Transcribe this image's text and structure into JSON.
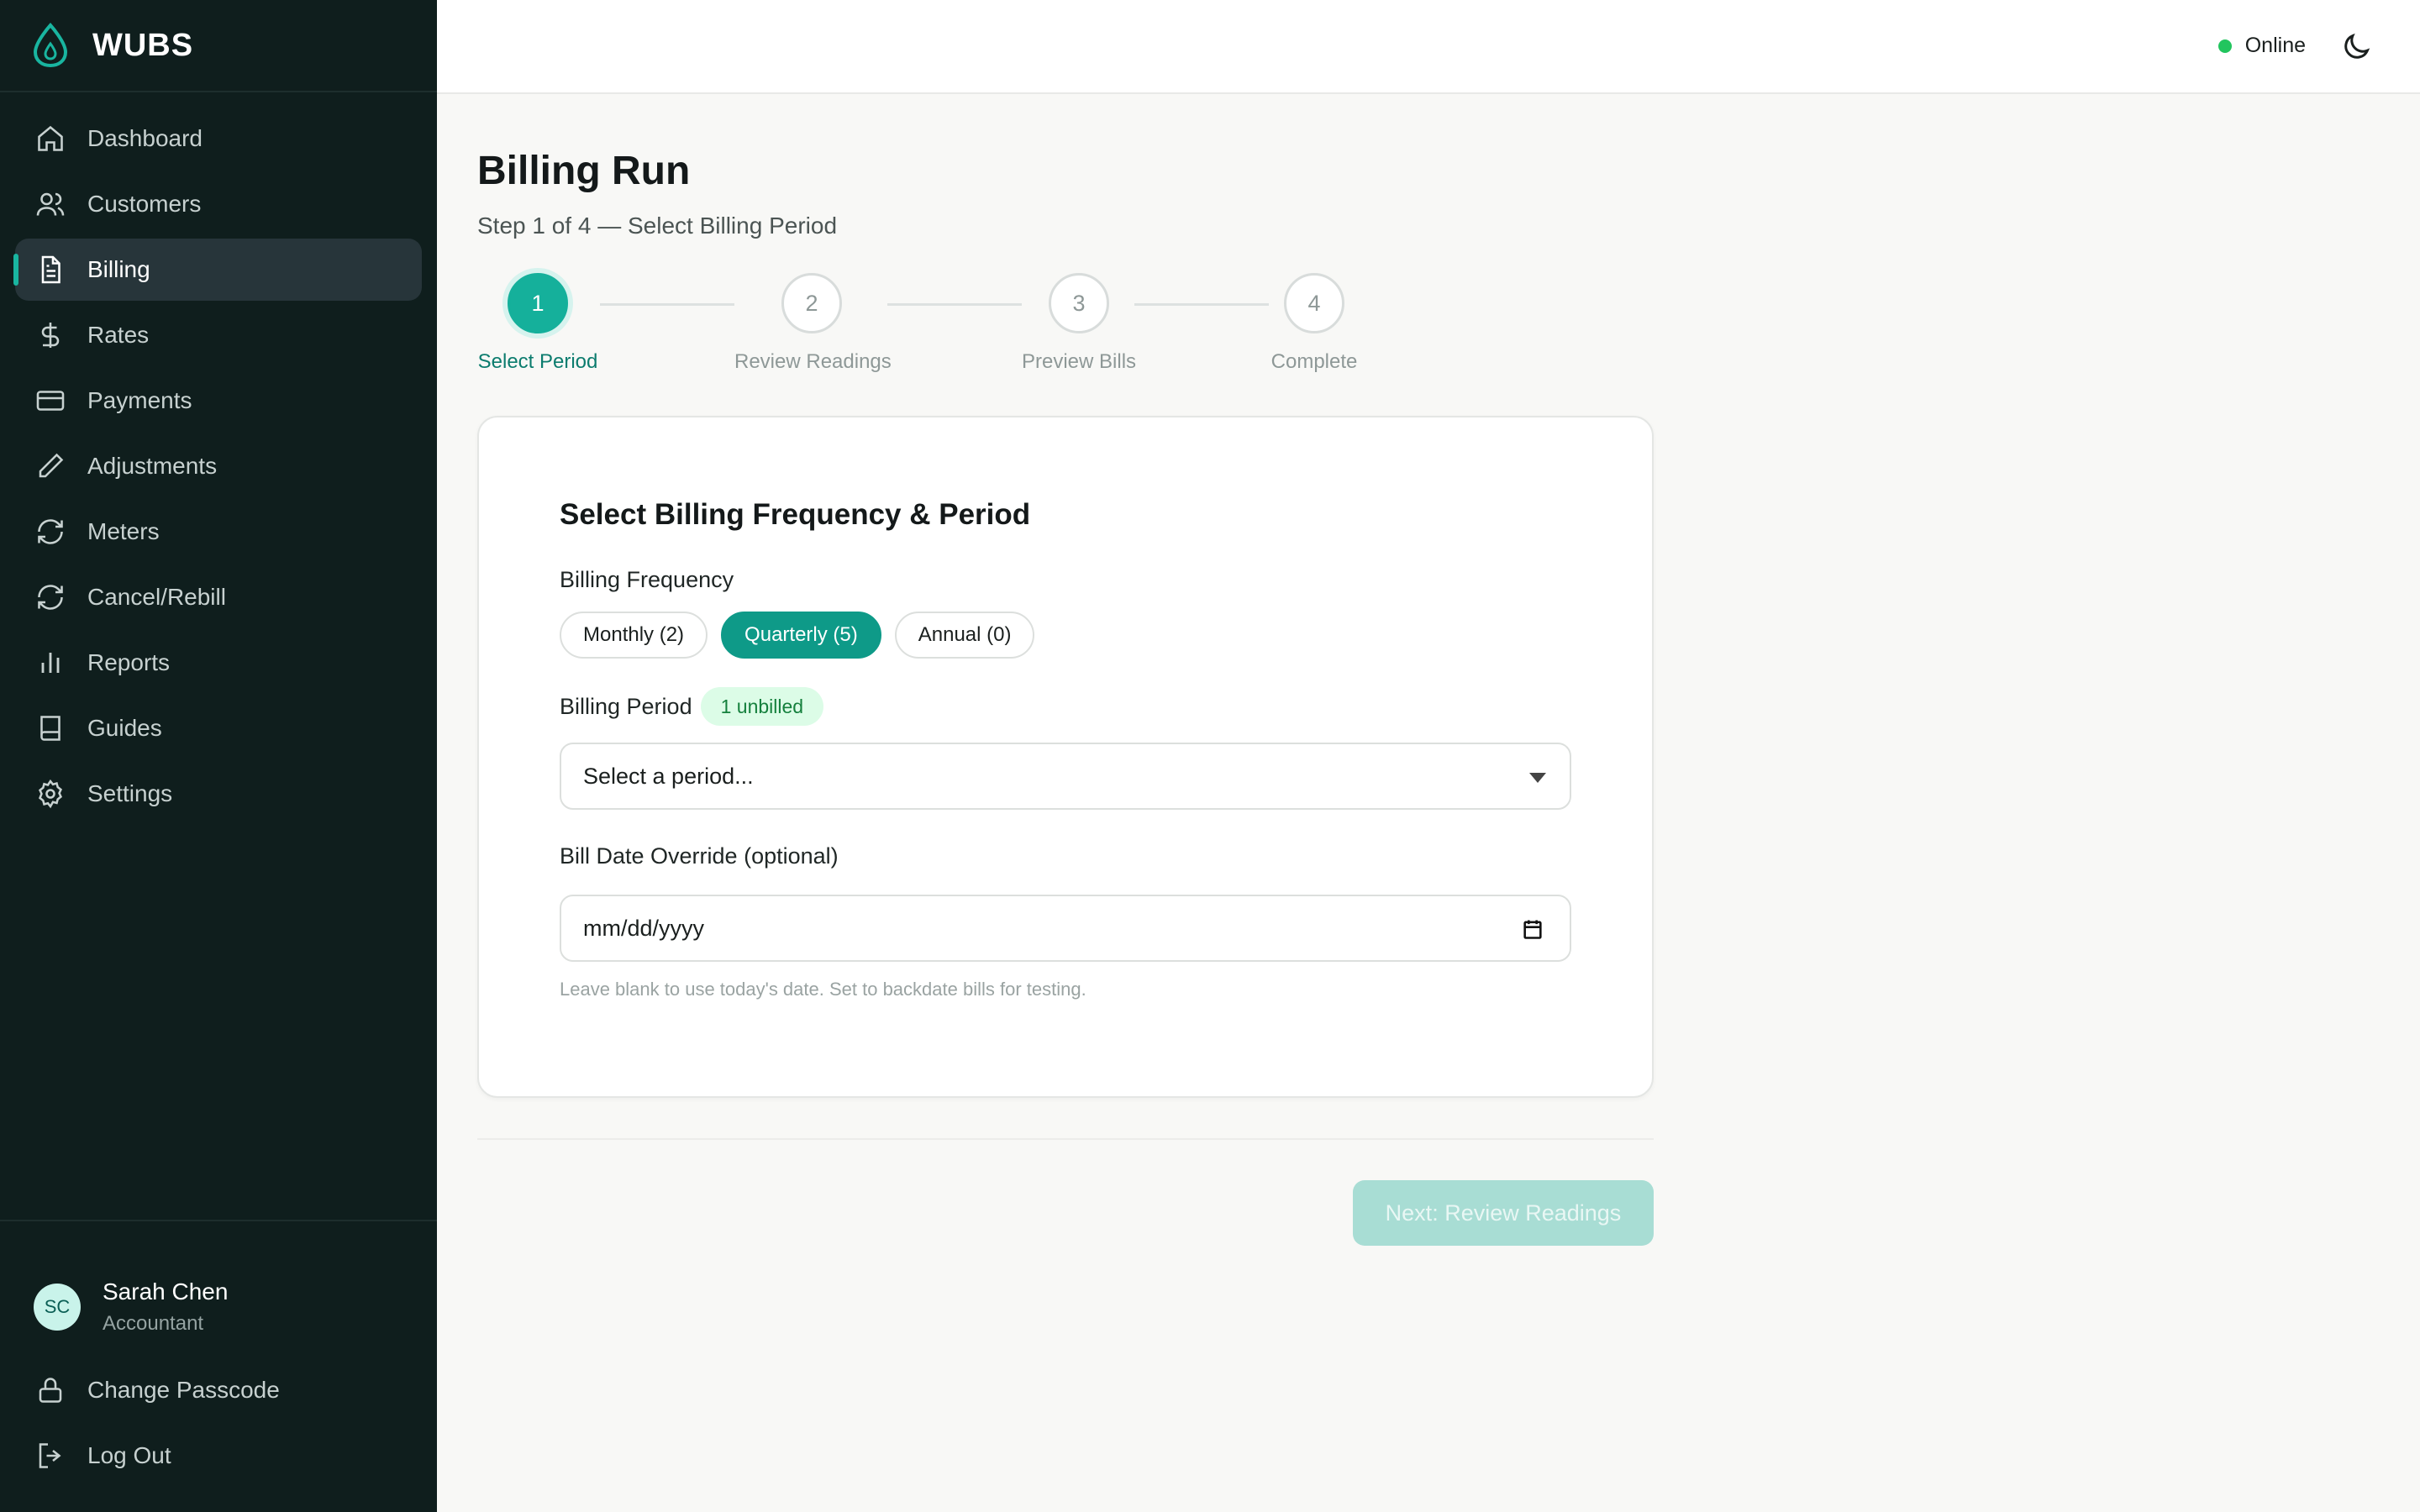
{
  "app": {
    "name": "WUBS"
  },
  "sidebar": {
    "items": [
      {
        "label": "Dashboard",
        "icon": "home-icon"
      },
      {
        "label": "Customers",
        "icon": "users-icon"
      },
      {
        "label": "Billing",
        "icon": "file-text-icon",
        "active": true
      },
      {
        "label": "Rates",
        "icon": "dollar-icon"
      },
      {
        "label": "Payments",
        "icon": "credit-card-icon"
      },
      {
        "label": "Adjustments",
        "icon": "pencil-icon"
      },
      {
        "label": "Meters",
        "icon": "refresh-icon"
      },
      {
        "label": "Cancel/Rebill",
        "icon": "refresh-icon"
      },
      {
        "label": "Reports",
        "icon": "bar-chart-icon"
      },
      {
        "label": "Guides",
        "icon": "book-icon"
      },
      {
        "label": "Settings",
        "icon": "gear-icon"
      }
    ],
    "user": {
      "initials": "SC",
      "name": "Sarah Chen",
      "role": "Accountant"
    },
    "bottom": [
      {
        "label": "Change Passcode",
        "icon": "lock-icon"
      },
      {
        "label": "Log Out",
        "icon": "logout-icon"
      }
    ]
  },
  "topbar": {
    "status": "Online",
    "status_color": "#22c55e",
    "theme_icon": "moon-icon"
  },
  "page": {
    "title": "Billing Run",
    "subtitle": "Step 1 of 4 — Select Billing Period"
  },
  "stepper": {
    "steps": [
      {
        "num": "1",
        "label": "Select Period",
        "active": true
      },
      {
        "num": "2",
        "label": "Review Readings"
      },
      {
        "num": "3",
        "label": "Preview Bills"
      },
      {
        "num": "4",
        "label": "Complete"
      }
    ]
  },
  "card": {
    "title": "Select Billing Frequency & Period",
    "frequency_label": "Billing Frequency",
    "frequencies": [
      {
        "label": "Monthly (2)"
      },
      {
        "label": "Quarterly (5)",
        "active": true
      },
      {
        "label": "Annual (0)"
      }
    ],
    "period_label": "Billing Period",
    "period_badge": "1 unbilled",
    "period_placeholder": "Select a period...",
    "date_label": "Bill Date Override (optional)",
    "date_placeholder": "mm/dd/yyyy",
    "date_hint": "Leave blank to use today's date. Set to backdate bills for testing."
  },
  "actions": {
    "next_label": "Next: Review Readings"
  },
  "colors": {
    "accent": "#15b09b",
    "sidebar_bg": "#0f1e1d",
    "badge_bg": "#dcfce7"
  }
}
